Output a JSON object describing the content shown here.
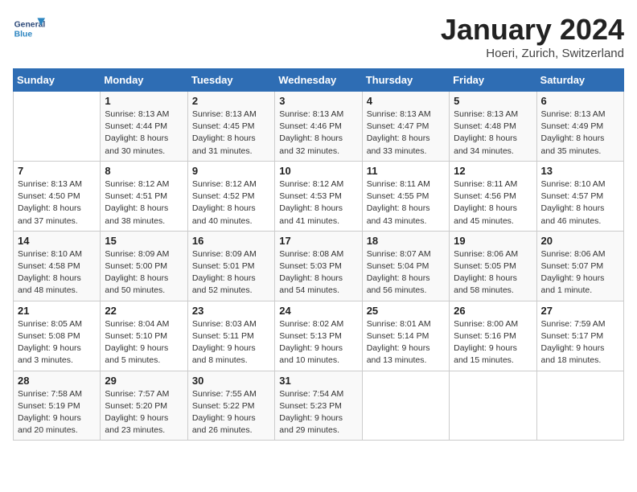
{
  "header": {
    "logo_general": "General",
    "logo_blue": "Blue",
    "title": "January 2024",
    "location": "Hoeri, Zurich, Switzerland"
  },
  "columns": [
    "Sunday",
    "Monday",
    "Tuesday",
    "Wednesday",
    "Thursday",
    "Friday",
    "Saturday"
  ],
  "weeks": [
    [
      {
        "num": "",
        "info": ""
      },
      {
        "num": "1",
        "info": "Sunrise: 8:13 AM\nSunset: 4:44 PM\nDaylight: 8 hours\nand 30 minutes."
      },
      {
        "num": "2",
        "info": "Sunrise: 8:13 AM\nSunset: 4:45 PM\nDaylight: 8 hours\nand 31 minutes."
      },
      {
        "num": "3",
        "info": "Sunrise: 8:13 AM\nSunset: 4:46 PM\nDaylight: 8 hours\nand 32 minutes."
      },
      {
        "num": "4",
        "info": "Sunrise: 8:13 AM\nSunset: 4:47 PM\nDaylight: 8 hours\nand 33 minutes."
      },
      {
        "num": "5",
        "info": "Sunrise: 8:13 AM\nSunset: 4:48 PM\nDaylight: 8 hours\nand 34 minutes."
      },
      {
        "num": "6",
        "info": "Sunrise: 8:13 AM\nSunset: 4:49 PM\nDaylight: 8 hours\nand 35 minutes."
      }
    ],
    [
      {
        "num": "7",
        "info": "Sunrise: 8:13 AM\nSunset: 4:50 PM\nDaylight: 8 hours\nand 37 minutes."
      },
      {
        "num": "8",
        "info": "Sunrise: 8:12 AM\nSunset: 4:51 PM\nDaylight: 8 hours\nand 38 minutes."
      },
      {
        "num": "9",
        "info": "Sunrise: 8:12 AM\nSunset: 4:52 PM\nDaylight: 8 hours\nand 40 minutes."
      },
      {
        "num": "10",
        "info": "Sunrise: 8:12 AM\nSunset: 4:53 PM\nDaylight: 8 hours\nand 41 minutes."
      },
      {
        "num": "11",
        "info": "Sunrise: 8:11 AM\nSunset: 4:55 PM\nDaylight: 8 hours\nand 43 minutes."
      },
      {
        "num": "12",
        "info": "Sunrise: 8:11 AM\nSunset: 4:56 PM\nDaylight: 8 hours\nand 45 minutes."
      },
      {
        "num": "13",
        "info": "Sunrise: 8:10 AM\nSunset: 4:57 PM\nDaylight: 8 hours\nand 46 minutes."
      }
    ],
    [
      {
        "num": "14",
        "info": "Sunrise: 8:10 AM\nSunset: 4:58 PM\nDaylight: 8 hours\nand 48 minutes."
      },
      {
        "num": "15",
        "info": "Sunrise: 8:09 AM\nSunset: 5:00 PM\nDaylight: 8 hours\nand 50 minutes."
      },
      {
        "num": "16",
        "info": "Sunrise: 8:09 AM\nSunset: 5:01 PM\nDaylight: 8 hours\nand 52 minutes."
      },
      {
        "num": "17",
        "info": "Sunrise: 8:08 AM\nSunset: 5:03 PM\nDaylight: 8 hours\nand 54 minutes."
      },
      {
        "num": "18",
        "info": "Sunrise: 8:07 AM\nSunset: 5:04 PM\nDaylight: 8 hours\nand 56 minutes."
      },
      {
        "num": "19",
        "info": "Sunrise: 8:06 AM\nSunset: 5:05 PM\nDaylight: 8 hours\nand 58 minutes."
      },
      {
        "num": "20",
        "info": "Sunrise: 8:06 AM\nSunset: 5:07 PM\nDaylight: 9 hours\nand 1 minute."
      }
    ],
    [
      {
        "num": "21",
        "info": "Sunrise: 8:05 AM\nSunset: 5:08 PM\nDaylight: 9 hours\nand 3 minutes."
      },
      {
        "num": "22",
        "info": "Sunrise: 8:04 AM\nSunset: 5:10 PM\nDaylight: 9 hours\nand 5 minutes."
      },
      {
        "num": "23",
        "info": "Sunrise: 8:03 AM\nSunset: 5:11 PM\nDaylight: 9 hours\nand 8 minutes."
      },
      {
        "num": "24",
        "info": "Sunrise: 8:02 AM\nSunset: 5:13 PM\nDaylight: 9 hours\nand 10 minutes."
      },
      {
        "num": "25",
        "info": "Sunrise: 8:01 AM\nSunset: 5:14 PM\nDaylight: 9 hours\nand 13 minutes."
      },
      {
        "num": "26",
        "info": "Sunrise: 8:00 AM\nSunset: 5:16 PM\nDaylight: 9 hours\nand 15 minutes."
      },
      {
        "num": "27",
        "info": "Sunrise: 7:59 AM\nSunset: 5:17 PM\nDaylight: 9 hours\nand 18 minutes."
      }
    ],
    [
      {
        "num": "28",
        "info": "Sunrise: 7:58 AM\nSunset: 5:19 PM\nDaylight: 9 hours\nand 20 minutes."
      },
      {
        "num": "29",
        "info": "Sunrise: 7:57 AM\nSunset: 5:20 PM\nDaylight: 9 hours\nand 23 minutes."
      },
      {
        "num": "30",
        "info": "Sunrise: 7:55 AM\nSunset: 5:22 PM\nDaylight: 9 hours\nand 26 minutes."
      },
      {
        "num": "31",
        "info": "Sunrise: 7:54 AM\nSunset: 5:23 PM\nDaylight: 9 hours\nand 29 minutes."
      },
      {
        "num": "",
        "info": ""
      },
      {
        "num": "",
        "info": ""
      },
      {
        "num": "",
        "info": ""
      }
    ]
  ]
}
